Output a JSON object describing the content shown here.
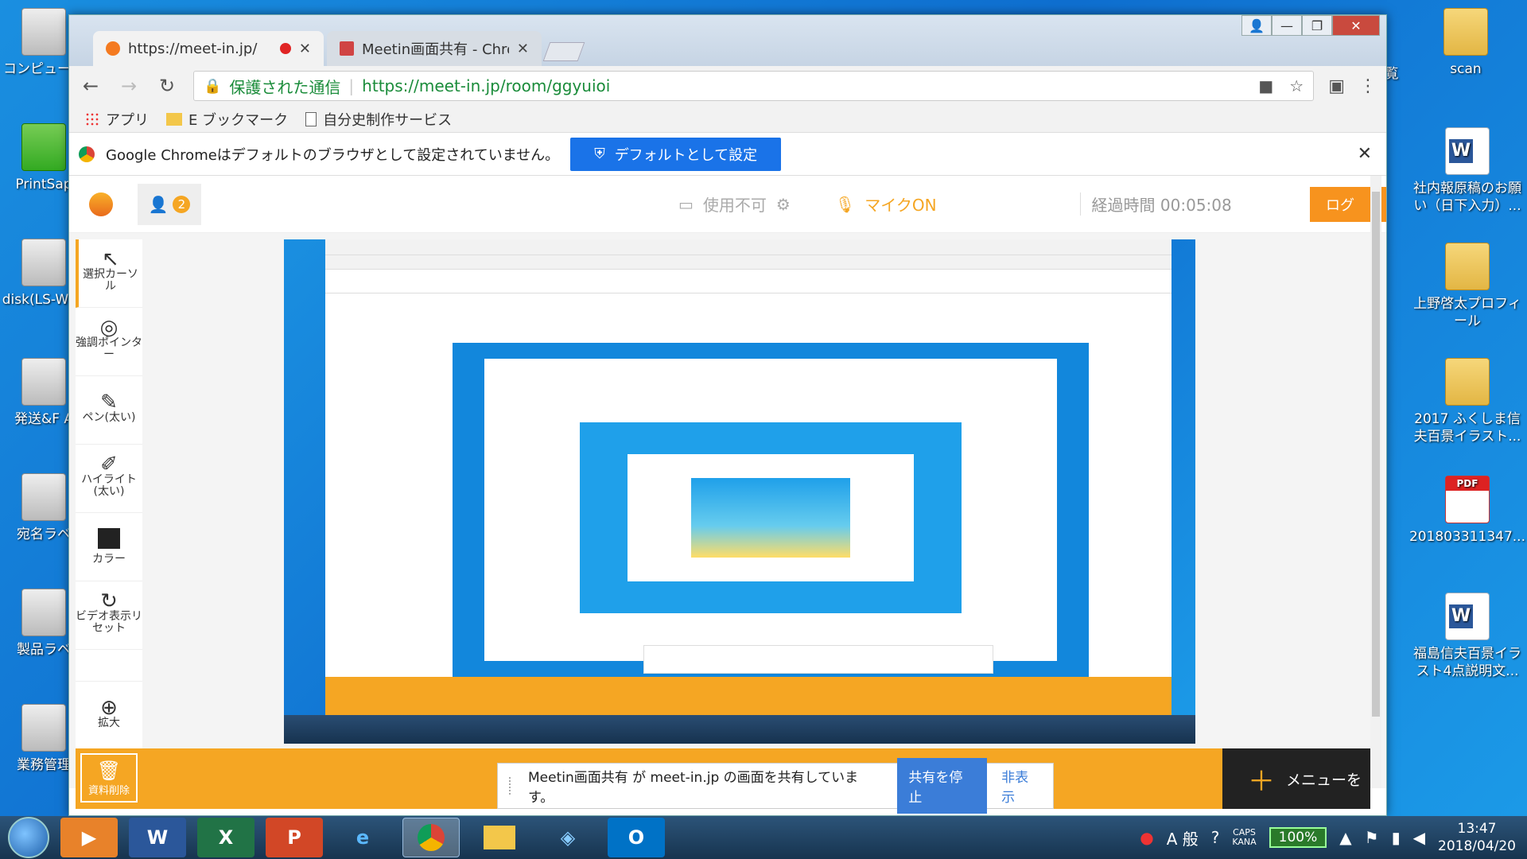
{
  "desktop": {
    "left_icons": [
      "コンピュータ",
      "PrintSap",
      "disk(LS-WVL",
      "発送&F A",
      "宛名ラベ",
      "製品ラベ",
      "業務管理"
    ],
    "right_icons": [
      {
        "label": "scan",
        "type": "folder"
      },
      {
        "label": "社内報原稿のお願い（日下入力）...",
        "type": "word"
      },
      {
        "label": "上野啓太プロフィール",
        "type": "folder"
      },
      {
        "label": "2017 ふくしま信夫百景イラスト...",
        "type": "folder"
      },
      {
        "label": "201803311347...",
        "type": "pdf"
      },
      {
        "label": "福島信夫百景イラスト4点説明文...",
        "type": "word"
      }
    ],
    "partial_label": "覧"
  },
  "browser": {
    "tabs": [
      {
        "title": "https://meet-in.jp/",
        "active": true
      },
      {
        "title": "Meetin画面共有 - Chrom",
        "active": false
      }
    ],
    "address": {
      "secure_label": "保護された通信",
      "url": "https://meet-in.jp/room/ggyuioi"
    },
    "bookmarks": [
      "アプリ",
      "E ブックマーク",
      "自分史制作サービス"
    ],
    "infobar": {
      "message": "Google Chromeはデフォルトのブラウザとして設定されていません。",
      "button": "デフォルトとして設定"
    }
  },
  "app": {
    "participants": "2",
    "camera_label": "使用不可",
    "mic_label": "マイクON",
    "elapsed": "経過時間 00:05:08",
    "logout_label": "ログ",
    "tools": [
      {
        "label": "選択カーソル",
        "icon": "cursor-icon"
      },
      {
        "label": "強調ポインター",
        "icon": "target-icon"
      },
      {
        "label": "ペン(太い)",
        "icon": "pen-icon"
      },
      {
        "label": "ハイライト(太い)",
        "icon": "highlight-icon"
      },
      {
        "label": "カラー",
        "icon": "color-icon"
      },
      {
        "label": "ビデオ表示リセット",
        "icon": "reset-icon"
      },
      {
        "label": "拡大",
        "icon": "zoom-in-icon"
      }
    ],
    "trash_label": "資料削除",
    "share_notice": {
      "message": "Meetin画面共有 が meet-in.jp の画面を共有しています。",
      "stop": "共有を停止",
      "hide": "非表示"
    },
    "menu_label": "メニューを"
  },
  "taskbar": {
    "battery": "100%",
    "caps": "CAPS",
    "kana": "KANA",
    "time": "13:47",
    "date": "2018/04/20",
    "ime": "A 般"
  },
  "colors": {
    "accent": "#f5a623",
    "link": "#3b7dd8",
    "secure": "#1a8c3a"
  }
}
